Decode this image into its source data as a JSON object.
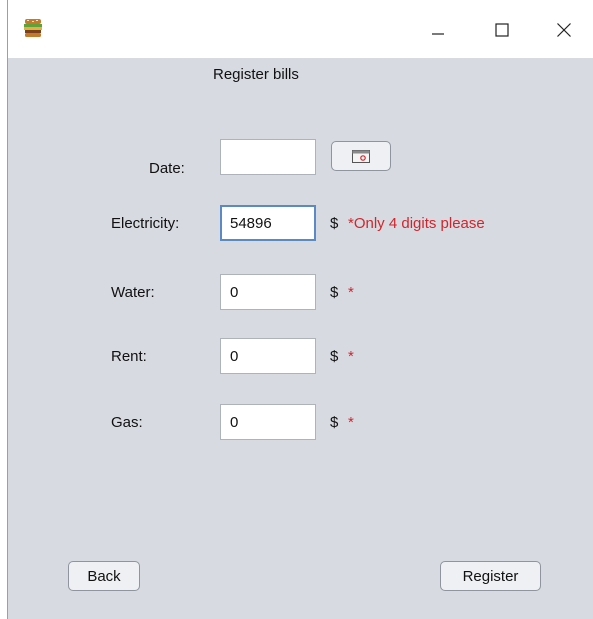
{
  "window": {
    "app_icon": "burger-icon",
    "controls": {
      "minimize": "minimize-icon",
      "maximize": "maximize-icon",
      "close": "close-icon"
    }
  },
  "form": {
    "title": "Register bills",
    "date": {
      "label": "Date:",
      "value": "",
      "picker_icon": "calendar-icon"
    },
    "electricity": {
      "label": "Electricity:",
      "value": "54896",
      "currency": "$",
      "note": "*Only 4 digits please"
    },
    "water": {
      "label": "Water:",
      "value": "0",
      "currency": "$",
      "note": "*"
    },
    "rent": {
      "label": "Rent:",
      "value": "0",
      "currency": "$",
      "note": "*"
    },
    "gas": {
      "label": "Gas:",
      "value": "0",
      "currency": "$",
      "note": "*"
    }
  },
  "buttons": {
    "back": "Back",
    "register": "Register"
  },
  "colors": {
    "background": "#d7dae1",
    "error": "#d0262b",
    "focus_border": "#5a89c5"
  }
}
